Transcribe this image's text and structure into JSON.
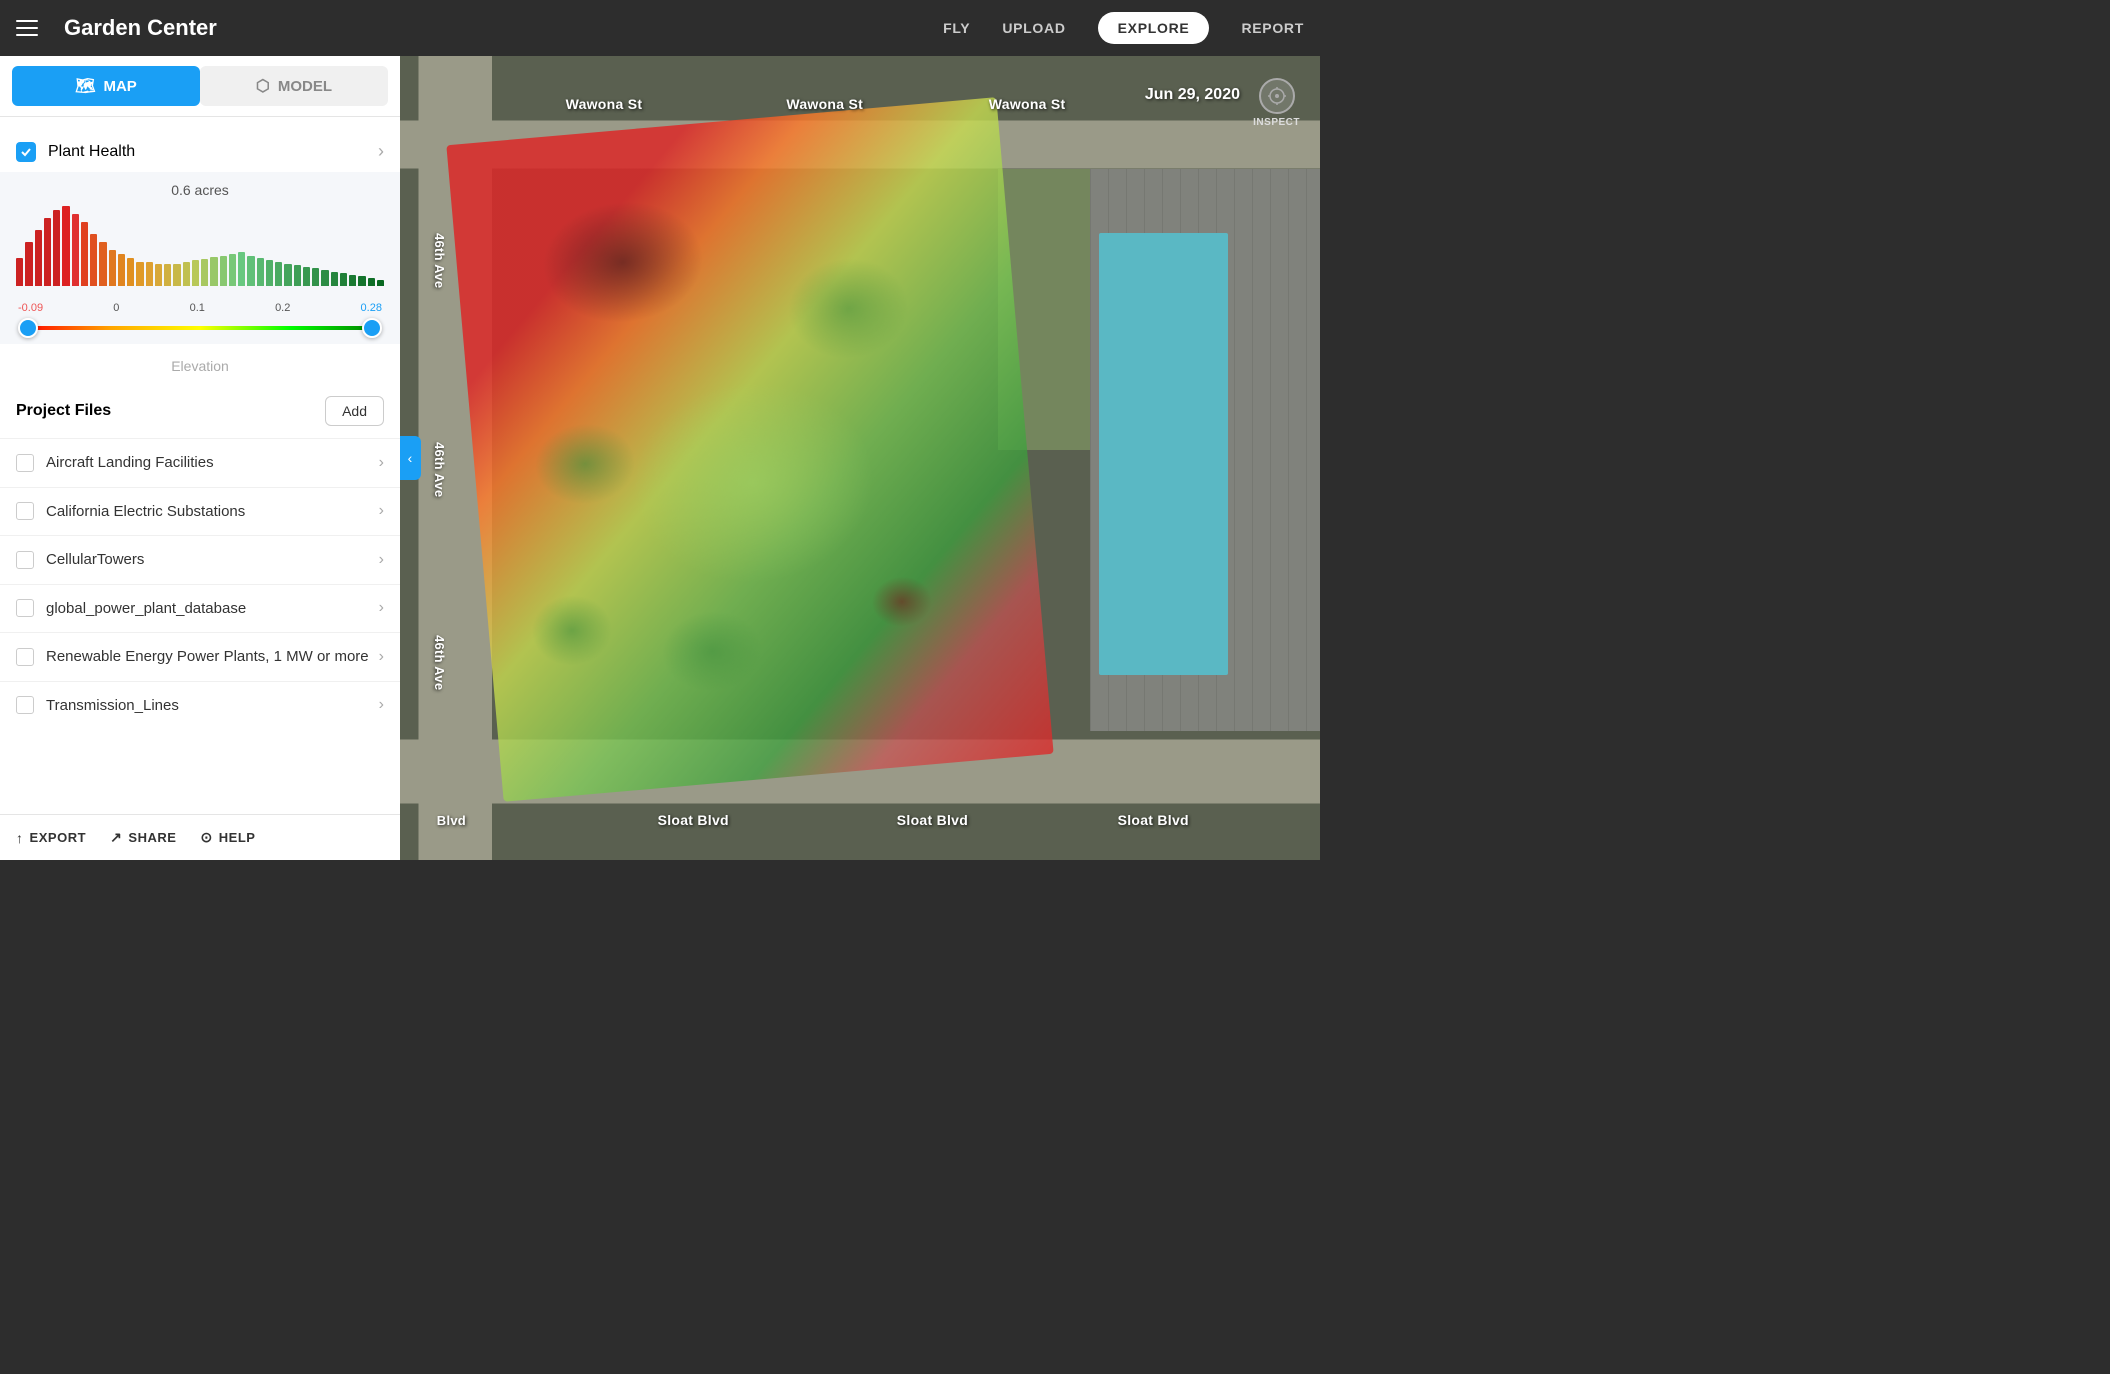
{
  "header": {
    "menu_label": "Menu",
    "title": "Garden Center",
    "nav": {
      "fly": "FLY",
      "upload": "UPLOAD",
      "explore": "EXPLORE",
      "report": "REPORT"
    }
  },
  "sidebar": {
    "view_toggle": {
      "map_label": "MAP",
      "model_label": "MODEL"
    },
    "plant_health": {
      "label": "Plant Health",
      "checked": true,
      "acres": "0.6 acres"
    },
    "histogram": {
      "min_label": "-0.09",
      "zero_label": "0",
      "point1_label": "0.1",
      "point2_label": "0.2",
      "max_label": "0.28"
    },
    "elevation": {
      "label": "Elevation"
    },
    "project_files": {
      "title": "Project Files",
      "add_button": "Add",
      "items": [
        {
          "name": "Aircraft Landing Facilities",
          "checked": false
        },
        {
          "name": "California Electric Substations",
          "checked": false
        },
        {
          "name": "CellularTowers",
          "checked": false
        },
        {
          "name": "global_power_plant_database",
          "checked": false
        },
        {
          "name": "Renewable Energy Power Plants, 1 MW or more",
          "checked": false
        },
        {
          "name": "Transmission_Lines",
          "checked": false
        }
      ]
    },
    "bottom": {
      "export": "EXPORT",
      "share": "SHARE",
      "help": "HELP"
    }
  },
  "map": {
    "date": "Jun 29, 2020",
    "inspect_label": "INSPECT",
    "streets": {
      "wawona_st_1": "Wawona St",
      "wawona_st_2": "Wawona St",
      "wawona_st_3": "Wawona St",
      "ave_46_1": "46th Ave",
      "ave_46_2": "46th Ave",
      "ave_46_3": "46th Ave",
      "sloat_blvd_1": "Sloat Blvd",
      "sloat_blvd_2": "Sloat Blvd",
      "sloat_blvd_3": "Sloat Blvd",
      "blvd_short": "Blvd"
    },
    "collapse_icon": "‹"
  },
  "colors": {
    "primary_blue": "#1a9ff5",
    "header_bg": "#2d2d2d",
    "sidebar_bg": "#ffffff",
    "histogram_bg": "#f5f7fa"
  }
}
